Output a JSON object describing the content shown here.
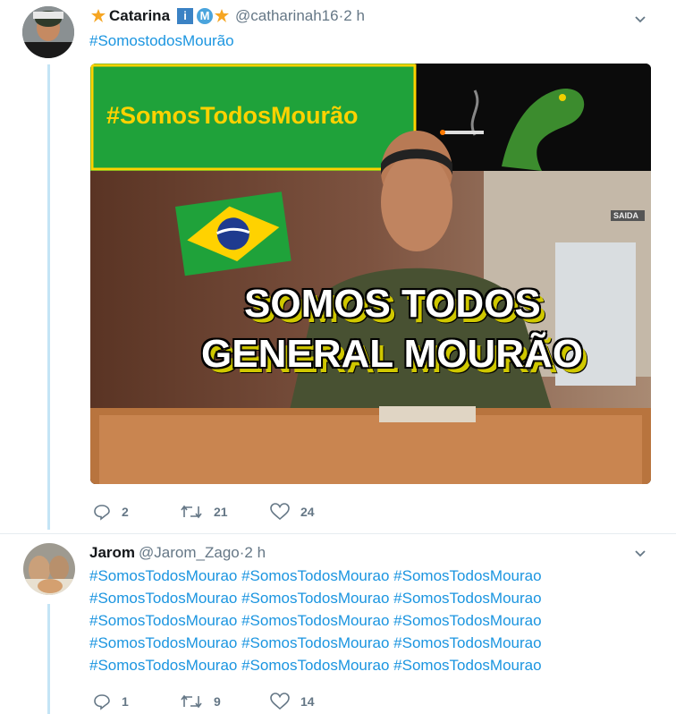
{
  "tweets": [
    {
      "author_name": "Catarina",
      "handle": "@catharinah16",
      "time": "2 h",
      "text": "#SomostodosMourão",
      "badges": [
        "sun-star",
        "info-i",
        "maria-m",
        "sun-star"
      ],
      "media": {
        "banner_text": "#SomosTodosMourão",
        "caption_line1": "SOMOS TODOS",
        "caption_line2": "GENERAL MOURÃO",
        "wall_sign": "SAIDA"
      },
      "replies": "2",
      "retweets": "21",
      "likes": "24"
    },
    {
      "author_name": "Jarom",
      "handle": "@Jarom_Zago",
      "time": "2 h",
      "text_lines": [
        "#SomosTodosMourao #SomosTodosMourao #SomosTodosMourao",
        "#SomosTodosMourao #SomosTodosMourao #SomosTodosMourao",
        "#SomosTodosMourao #SomosTodosMourao #SomosTodosMourao",
        "#SomosTodosMourao #SomosTodosMourao #SomosTodosMourao",
        "#SomosTodosMourao #SomosTodosMourao #SomosTodosMourao"
      ],
      "replies": "1",
      "retweets": "9",
      "likes": "14"
    }
  ],
  "separator": " · ",
  "colors": {
    "link": "#1b95e0",
    "muted": "#657786",
    "thread": "#c4e4f5",
    "green": "#1fa23a",
    "yellow": "#ffd200"
  }
}
